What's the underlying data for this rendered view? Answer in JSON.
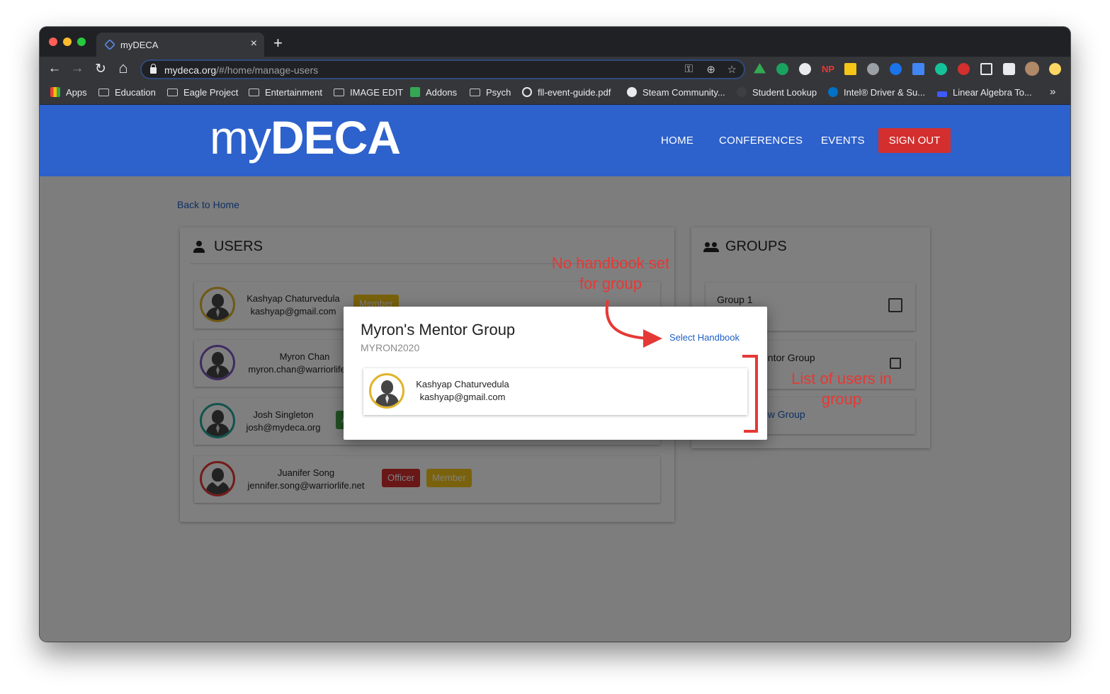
{
  "browser": {
    "tab_title": "myDECA",
    "tab_close": "×",
    "new_tab": "+",
    "nav": {
      "back": "←",
      "forward": "→",
      "reload": "↻",
      "home": "⌂"
    },
    "url_host": "mydeca.org",
    "url_path": "/#/home/manage-users",
    "bookmarks": [
      {
        "label": "Apps",
        "icon": "apps-grid-icon"
      },
      {
        "label": "Education",
        "icon": "folder-icon"
      },
      {
        "label": "Eagle Project",
        "icon": "folder-icon"
      },
      {
        "label": "Entertainment",
        "icon": "folder-icon"
      },
      {
        "label": "IMAGE EDIT",
        "icon": "folder-icon"
      },
      {
        "label": "Addons",
        "icon": "puzzle-icon"
      },
      {
        "label": "Psych",
        "icon": "folder-icon"
      },
      {
        "label": "fll-event-guide.pdf",
        "icon": "globe-icon"
      },
      {
        "label": "Steam Community...",
        "icon": "steam-icon"
      },
      {
        "label": "Student Lookup",
        "icon": "site-icon"
      },
      {
        "label": "Intel® Driver & Su...",
        "icon": "intel-icon"
      },
      {
        "label": "Linear Algebra To...",
        "icon": "site-icon"
      }
    ],
    "more_bookmarks": "»"
  },
  "header": {
    "logo_light": "my",
    "logo_bold": "DECA",
    "nav": {
      "home": "HOME",
      "conferences": "CONFERENCES",
      "events": "EVENTS",
      "signout": "SIGN OUT"
    }
  },
  "back_link": "Back to Home",
  "users": {
    "title": "USERS",
    "items": [
      {
        "name": "Kashyap Chaturvedula",
        "email": "kashyap@gmail.com",
        "ring": "#e0b32a",
        "badges": [
          "Member"
        ]
      },
      {
        "name": "Myron Chan",
        "email": "myron.chan@warriorlife.net",
        "ring": "#7e57c2",
        "badges": []
      },
      {
        "name": "Josh Singleton",
        "email": "josh@mydeca.org",
        "ring": "#26a69a",
        "badges": [
          "A"
        ]
      },
      {
        "name": "Juanifer Song",
        "email": "jennifer.song@warriorlife.net",
        "ring": "#e53935",
        "badges": [
          "Officer",
          "Member"
        ]
      }
    ]
  },
  "groups": {
    "title": "GROUPS",
    "items": [
      {
        "name": "Group 1"
      },
      {
        "name": "entor Group"
      }
    ],
    "new_group": "ew Group"
  },
  "modal": {
    "title": "Myron's Mentor Group",
    "code": "MYRON2020",
    "select_handbook": "Select Handbook",
    "member": {
      "name": "Kashyap Chaturvedula",
      "email": "kashyap@gmail.com",
      "ring": "#e0b32a"
    }
  },
  "annotations": {
    "handbook_line1": "No handbook set",
    "handbook_line2": "for group",
    "users_line1": "List of users in",
    "users_line2": "group",
    "color": "#e53935"
  },
  "colors": {
    "header": "#2d61cc",
    "signout": "#d32f2f",
    "officer": "#d32f2f",
    "member": "#f5c518",
    "link": "#1e5fc6"
  }
}
